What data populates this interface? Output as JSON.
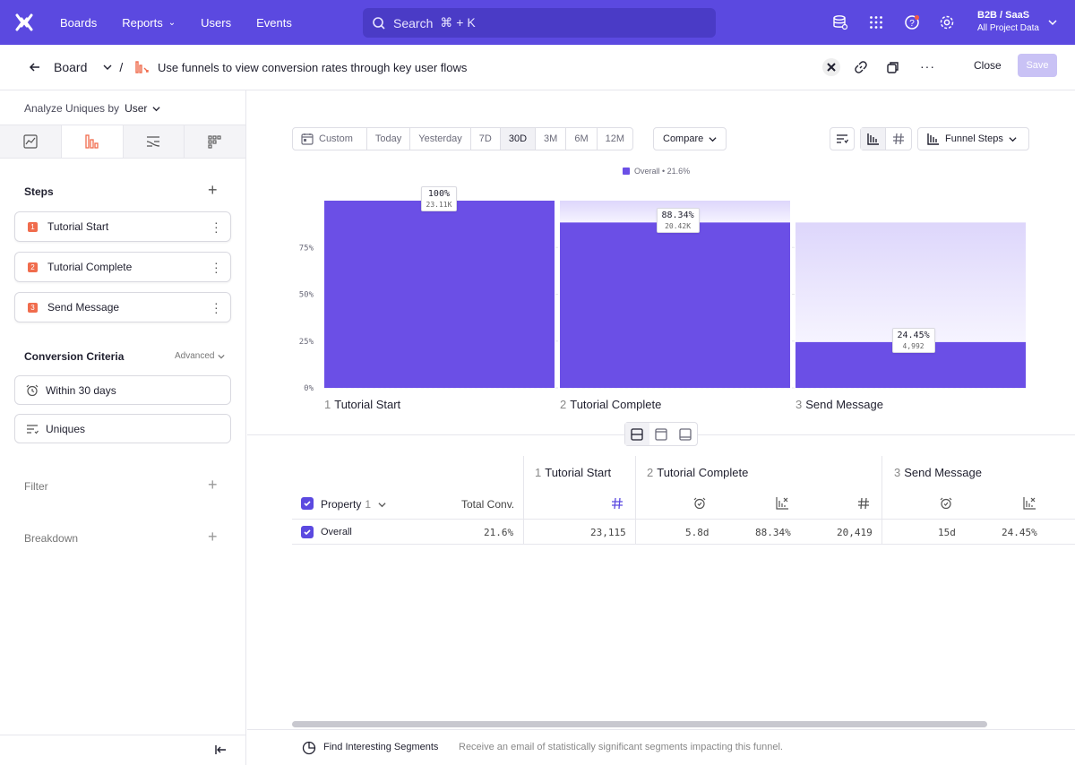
{
  "nav": {
    "items": [
      "Boards",
      "Reports",
      "Users",
      "Events"
    ],
    "search_placeholder": "Search",
    "search_shortcut": "⌘ + K",
    "project_title": "B2B / SaaS",
    "project_subtitle": "All Project Data"
  },
  "header": {
    "back_label": "Board",
    "separator": "/",
    "report_title": "Use funnels to view conversion rates through key user flows",
    "close_label": "Close",
    "save_label": "Save"
  },
  "sidebar": {
    "analyze_prefix": "Analyze Uniques by",
    "analyze_value": "User",
    "steps_title": "Steps",
    "steps": [
      {
        "num": "1",
        "label": "Tutorial Start"
      },
      {
        "num": "2",
        "label": "Tutorial Complete"
      },
      {
        "num": "3",
        "label": "Send Message"
      }
    ],
    "criteria_title": "Conversion Criteria",
    "criteria_advanced": "Advanced",
    "criteria_window": "Within 30 days",
    "criteria_counting": "Uniques",
    "filter_title": "Filter",
    "breakdown_title": "Breakdown"
  },
  "toolbar": {
    "ranges": [
      "Custom",
      "Today",
      "Yesterday",
      "7D",
      "30D",
      "3M",
      "6M",
      "12M"
    ],
    "active_range": "30D",
    "compare_label": "Compare",
    "funnel_steps_label": "Funnel Steps"
  },
  "chart_data": {
    "type": "bar",
    "legend": "Overall • 21.6%",
    "categories": [
      "Tutorial Start",
      "Tutorial Complete",
      "Send Message"
    ],
    "step_numbers": [
      "1",
      "2",
      "3"
    ],
    "values": [
      100,
      88.34,
      24.45
    ],
    "value_labels": [
      "100%",
      "88.34%",
      "24.45%"
    ],
    "count_labels": [
      "23.11K",
      "20.42K",
      "4,992"
    ],
    "y_ticks": [
      "0%",
      "25%",
      "50%",
      "75%"
    ],
    "ylim": [
      0,
      100
    ],
    "bar_color": "#6b4fe6",
    "dropoff_color": "#ddd6fb"
  },
  "table": {
    "property_label": "Property",
    "property_count": "1",
    "total_conv_label": "Total Conv.",
    "steps": [
      {
        "num": "1",
        "label": "Tutorial Start"
      },
      {
        "num": "2",
        "label": "Tutorial Complete"
      },
      {
        "num": "3",
        "label": "Send Message"
      }
    ],
    "row": {
      "label": "Overall",
      "total_conv": "21.6%",
      "s1_count": "23,115",
      "s2_time": "5.8d",
      "s2_pct": "88.34%",
      "s2_count": "20,419",
      "s3_time": "15d",
      "s3_pct": "24.45%"
    }
  },
  "footer": {
    "title": "Find Interesting Segments",
    "description": "Receive an email of statistically significant segments impacting this funnel."
  }
}
